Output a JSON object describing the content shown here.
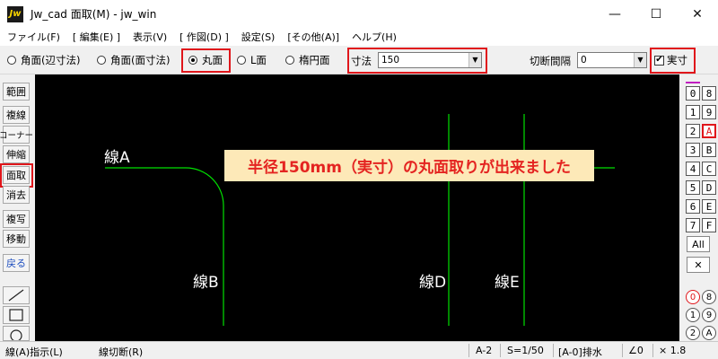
{
  "window": {
    "logo": "Jw",
    "title": "Jw_cad 面取(M) - jw_win",
    "minimize": "—",
    "maximize": "☐",
    "close": "✕"
  },
  "menu": [
    "ファイル(F)",
    "[ 編集(E) ]",
    "表示(V)",
    "[ 作図(D) ]",
    "設定(S)",
    "[その他(A)]",
    "ヘルプ(H)"
  ],
  "toolbar": {
    "radios": [
      "角面(辺寸法)",
      "角面(面寸法)",
      "丸面",
      "L面",
      "楕円面"
    ],
    "selected_radio": "丸面",
    "dimension_label": "寸法",
    "dimension_value": "150",
    "interval_label": "切断間隔",
    "interval_value": "0",
    "actual_size_label": "実寸",
    "actual_size_checked": "✔"
  },
  "left_tools": {
    "range": "範囲",
    "multi_line": "複線",
    "corner": "コーナー",
    "stretch": "伸縮",
    "chamfer": "面取",
    "erase": "消去",
    "copy": "複写",
    "move": "移動",
    "back": "戻る"
  },
  "canvas": {
    "labels": {
      "a": "線A",
      "b": "線B",
      "d": "線D",
      "e": "線E"
    },
    "banner": "半径150mm（実寸）の丸面取りが出来ました",
    "line_color": "#00e000"
  },
  "layers": {
    "numbers_left": [
      "0",
      "1",
      "2",
      "3",
      "4",
      "5",
      "6",
      "7"
    ],
    "numbers_right": [
      "8",
      "9",
      "A",
      "B",
      "C",
      "D",
      "E",
      "F"
    ],
    "all_label": "All",
    "cross_label": "✕",
    "circ_left": [
      "0",
      "1",
      "2"
    ],
    "circ_right": [
      "8",
      "9",
      "A"
    ]
  },
  "statusbar": {
    "left1": "線(A)指示(L)",
    "left2": "線切断(R)",
    "layer": "A-2",
    "scale": "S=1/50",
    "mode": "[A-0]排水",
    "angle": "∠0",
    "zoom": "× 1.8"
  },
  "accent_color": "#e0161b"
}
